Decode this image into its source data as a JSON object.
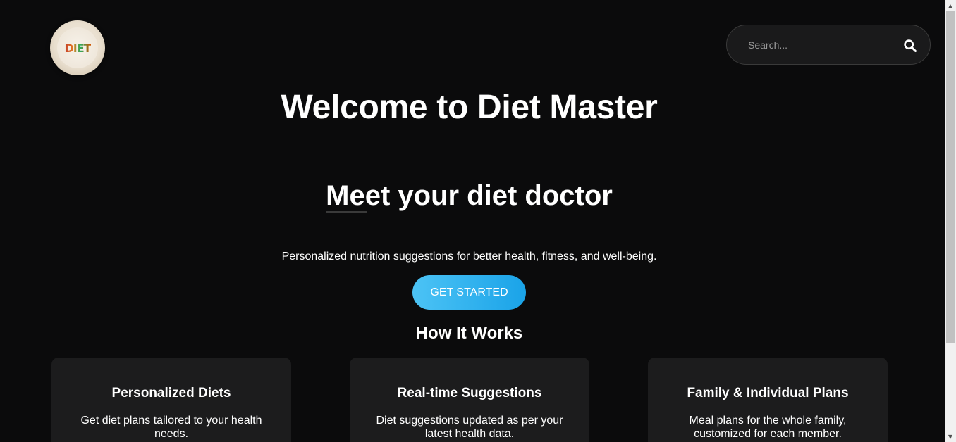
{
  "header": {
    "logo_text": "DIET",
    "search": {
      "placeholder": "Search..."
    }
  },
  "hero": {
    "title": "Welcome to Diet Master",
    "tagline": "Meet your diet doctor",
    "subtext": "Personalized nutrition suggestions for better health, fitness, and well-being.",
    "cta_label": "GET STARTED"
  },
  "how_it_works": {
    "heading": "How It Works",
    "cards": [
      {
        "title": "Personalized Diets",
        "description": "Get diet plans tailored to your health needs."
      },
      {
        "title": "Real-time Suggestions",
        "description": "Diet suggestions updated as per your latest health data."
      },
      {
        "title": "Family & Individual Plans",
        "description": "Meal plans for the whole family, customized for each member."
      }
    ]
  },
  "colors": {
    "background": "#0b0b0c",
    "card": "#1c1c1d",
    "accent_start": "#4cc3f5",
    "accent_end": "#1aa3e8"
  },
  "icons": {
    "search": "search-icon",
    "logo": "diet-plate-logo"
  }
}
